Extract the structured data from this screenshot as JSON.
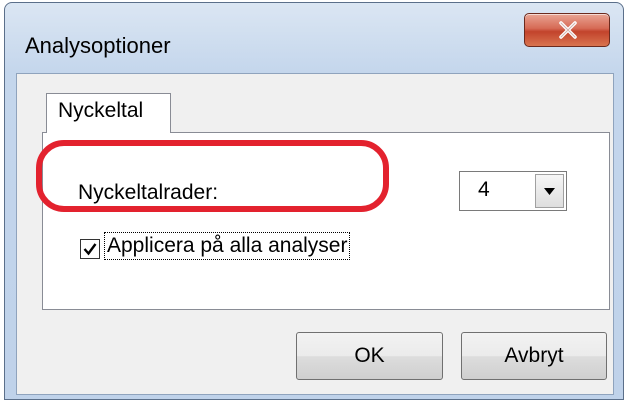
{
  "window": {
    "title": "Analysoptioner",
    "close_icon": "close-icon"
  },
  "tabs": [
    {
      "label": "Nyckeltal",
      "selected": true
    }
  ],
  "panel": {
    "rows_label": "Nyckeltalrader:",
    "rows_select": {
      "value": "4",
      "icon": "chevron-down-icon"
    },
    "apply_all": {
      "label": "Applicera på alla analyser",
      "checked": true
    }
  },
  "buttons": {
    "ok_label": "OK",
    "cancel_label": "Avbryt"
  },
  "colors": {
    "highlight": "#e3222e",
    "close_button": "#c2432c"
  }
}
